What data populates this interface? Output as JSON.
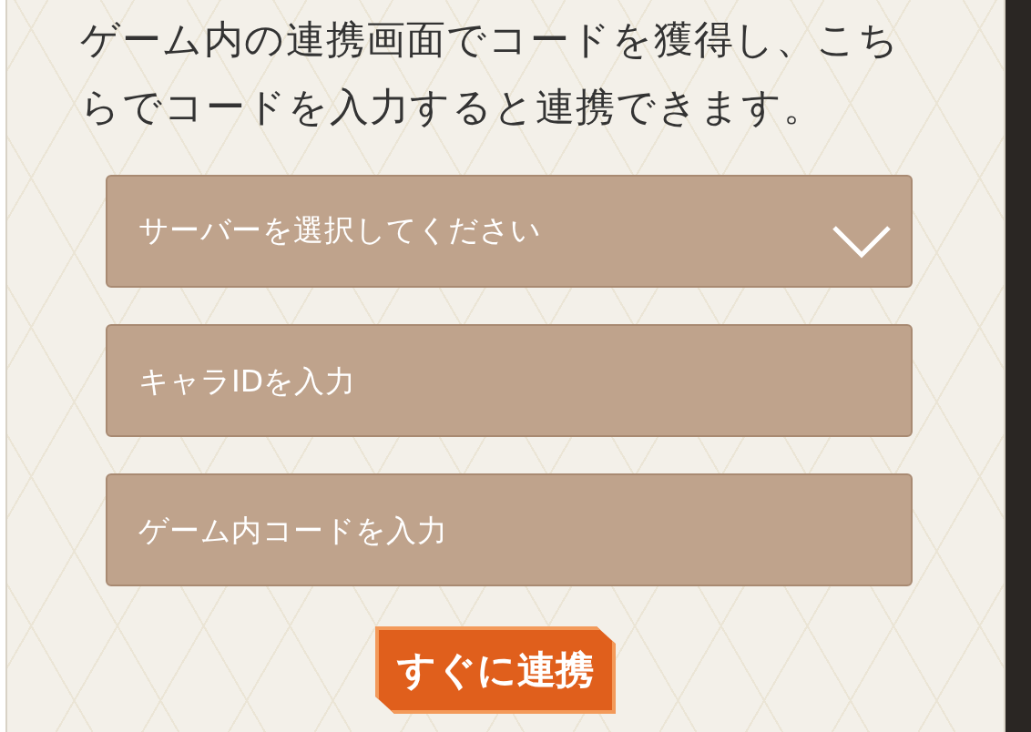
{
  "intro": "ゲーム内の連携画面でコードを獲得し、こちらでコードを入力すると連携できます。",
  "fields": [
    {
      "kind": "select",
      "placeholder": "サーバーを選択してください"
    },
    {
      "kind": "text",
      "placeholder": "キャラIDを入力"
    },
    {
      "kind": "text",
      "placeholder": "ゲーム内コードを入力"
    }
  ],
  "submit": "すぐに連携"
}
